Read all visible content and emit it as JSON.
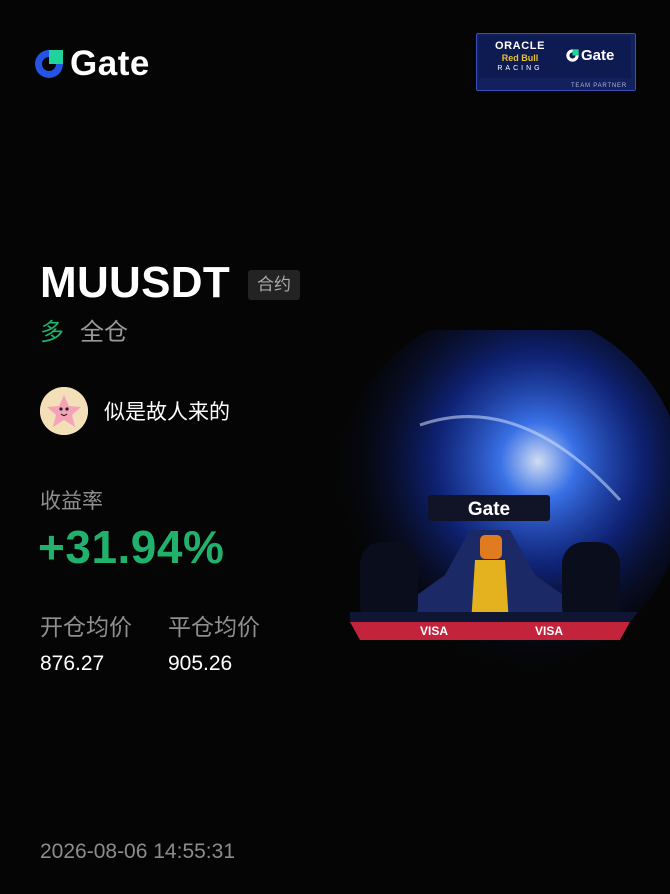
{
  "header": {
    "brand_name": "Gate",
    "partner": {
      "line1": "ORACLE",
      "line2": "Red Bull",
      "line3": "RACING",
      "brand": "Gate",
      "caption": "TEAM PARTNER"
    }
  },
  "position": {
    "symbol": "MUUSDT",
    "type_tag": "合约",
    "side": "多",
    "margin_mode": "全仓"
  },
  "user": {
    "name": "似是故人来的"
  },
  "roi": {
    "label": "收益率",
    "value": "+31.94%"
  },
  "prices": {
    "entry_label": "开仓均价",
    "entry_value": "876.27",
    "exit_label": "平仓均价",
    "exit_value": "905.26"
  },
  "timestamp": "2026-08-06 14:55:31",
  "car": {
    "wing_text": "Gate",
    "sidepod_text": "VISA"
  },
  "colors": {
    "background": "#050505",
    "profit_green": "#20b26c",
    "brand_blue": "#2354e6",
    "glow_blue": "#1f5bff"
  }
}
